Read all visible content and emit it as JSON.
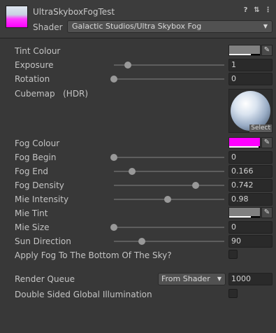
{
  "header": {
    "material_name": "UltraSkyboxFogTest",
    "shader_label": "Shader",
    "shader_value": "Galactic Studios/Ultra Skybox Fog",
    "icons": [
      "help-icon",
      "settings-sliders-icon",
      "kebab-menu-icon"
    ]
  },
  "props": {
    "tint_colour": {
      "label": "Tint Colour",
      "color": "#808080",
      "alpha": 0.7
    },
    "exposure": {
      "label": "Exposure",
      "value": "1",
      "fraction": 0.125
    },
    "rotation": {
      "label": "Rotation",
      "value": "0",
      "fraction": 0.0
    },
    "cubemap": {
      "label": "Cubemap",
      "hdr": "(HDR)",
      "select": "Select"
    },
    "fog_colour": {
      "label": "Fog Colour",
      "color": "#ff00ff",
      "alpha": 0.95
    },
    "fog_begin": {
      "label": "Fog Begin",
      "value": "0",
      "fraction": 0.0
    },
    "fog_end": {
      "label": "Fog End",
      "value": "0.166",
      "fraction": 0.166
    },
    "fog_density": {
      "label": "Fog Density",
      "value": "0.742",
      "fraction": 0.742
    },
    "mie_intensity": {
      "label": "Mie Intensity",
      "value": "0.98",
      "fraction": 0.49
    },
    "mie_tint": {
      "label": "Mie Tint",
      "color": "#808080",
      "alpha": 0.7
    },
    "mie_size": {
      "label": "Mie Size",
      "value": "0",
      "fraction": 0.0
    },
    "sun_direction": {
      "label": "Sun Direction",
      "value": "90",
      "fraction": 0.25
    },
    "apply_fog_bottom": {
      "label": "Apply Fog To The Bottom Of The Sky?",
      "checked": false
    },
    "render_queue": {
      "label": "Render Queue",
      "dropdown": "From Shader",
      "value": "1000"
    },
    "double_sided_gi": {
      "label": "Double Sided Global Illumination",
      "checked": false
    }
  }
}
